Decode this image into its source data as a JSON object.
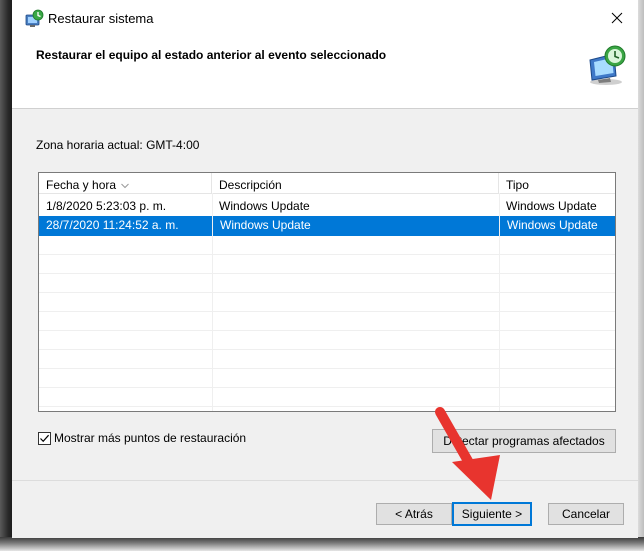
{
  "window": {
    "title": "Restaurar sistema",
    "header_title": "Restaurar el equipo al estado anterior al evento seleccionado"
  },
  "timezone_label": "Zona horaria actual: GMT-4:00",
  "table": {
    "columns": [
      "Fecha y hora",
      "Descripción",
      "Tipo"
    ],
    "rows": [
      {
        "fecha": "1/8/2020 5:23:03 p. m.",
        "descripcion": "Windows Update",
        "tipo": "Windows Update",
        "selected": false
      },
      {
        "fecha": "28/7/2020 11:24:52 a. m.",
        "descripcion": "Windows Update",
        "tipo": "Windows Update",
        "selected": true
      }
    ]
  },
  "checkbox": {
    "label": "Mostrar más puntos de restauración",
    "checked": true
  },
  "buttons": {
    "detect": "Detectar programas afectados",
    "back": "< Atrás",
    "next": "Siguiente >",
    "cancel": "Cancelar"
  },
  "colors": {
    "selection": "#0078d7",
    "annotation_arrow": "#e8342e"
  },
  "icons": {
    "title": "system-restore-icon",
    "header": "system-restore-large-icon",
    "close": "close-icon"
  }
}
